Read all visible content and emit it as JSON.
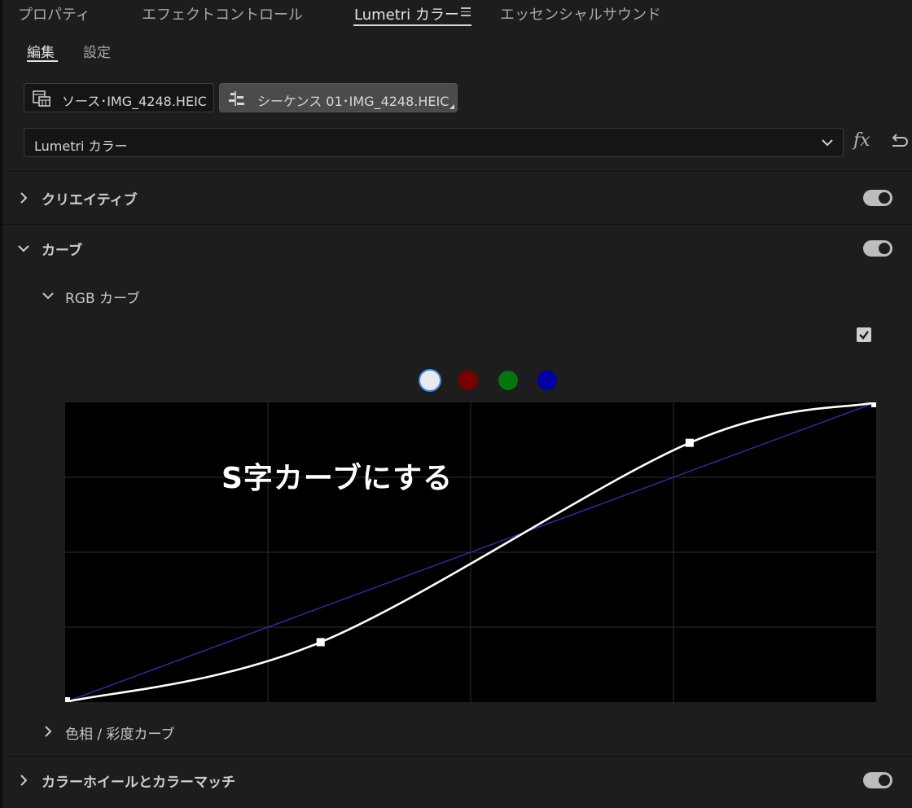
{
  "panel_tabs": [
    "プロパティ",
    "エフェクトコントロール",
    "Lumetri カラー",
    "エッセンシャルサウンド"
  ],
  "subtabs": {
    "edit": "編集",
    "settings": "設定"
  },
  "clips": {
    "source": "ソース･IMG_4248.HEIC",
    "sequence": "シーケンス 01･IMG_4248.HEIC"
  },
  "effect_select": {
    "value": "Lumetri カラー"
  },
  "fx_label": "fx",
  "sections": {
    "creative": "クリエイティブ",
    "curves": "カーブ",
    "rgb_curve": "RGB カーブ",
    "hue_sat": "色相 / 彩度カーブ",
    "wheels": "カラーホイールとカラーマッチ"
  },
  "curve": {
    "channel_colors": {
      "white": "#eaeaea",
      "red": "#7a0000",
      "green": "#00760d",
      "blue": "#0000a6"
    },
    "selected_channel": "white",
    "enabled": true,
    "control_points": [
      [
        0,
        0
      ],
      [
        0.315,
        0.2
      ],
      [
        0.77,
        0.865
      ],
      [
        1,
        1
      ]
    ],
    "annotation": "S字カーブにする"
  },
  "colors": {
    "background": "#1d1d1d",
    "accent": "#3b8cf2",
    "curve_line": "#ffffff",
    "diagonal": "#2c34b8"
  }
}
